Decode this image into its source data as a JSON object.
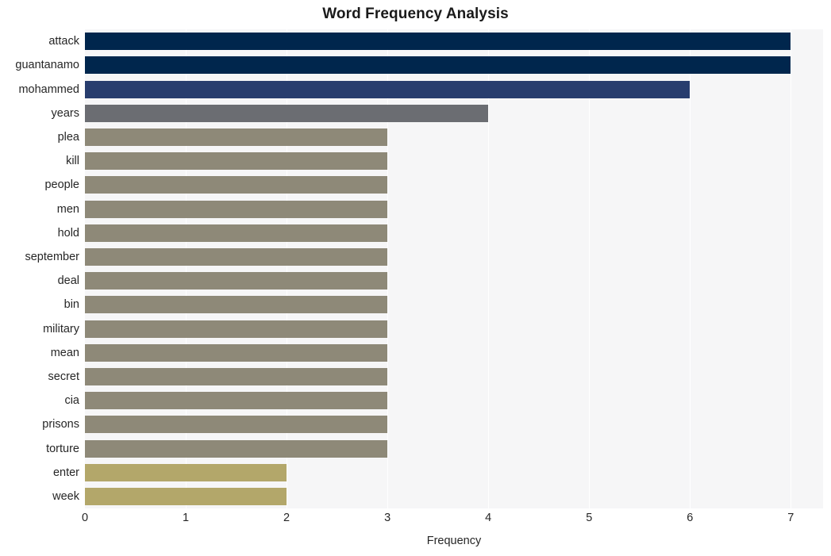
{
  "chart_data": {
    "type": "bar",
    "orientation": "horizontal",
    "title": "Word Frequency Analysis",
    "xlabel": "Frequency",
    "ylabel": "",
    "xlim": [
      0,
      7.32
    ],
    "xticks": [
      0,
      1,
      2,
      3,
      4,
      5,
      6,
      7
    ],
    "xtick_labels": [
      "0",
      "1",
      "2",
      "3",
      "4",
      "5",
      "6",
      "7"
    ],
    "grid": "vertical",
    "legend": "none",
    "categories": [
      "attack",
      "guantanamo",
      "mohammed",
      "years",
      "plea",
      "kill",
      "people",
      "men",
      "hold",
      "september",
      "deal",
      "bin",
      "military",
      "mean",
      "secret",
      "cia",
      "prisons",
      "torture",
      "enter",
      "week"
    ],
    "values": [
      7,
      7,
      6,
      4,
      3,
      3,
      3,
      3,
      3,
      3,
      3,
      3,
      3,
      3,
      3,
      3,
      3,
      3,
      2,
      2
    ],
    "bar_colors": [
      "#00264d",
      "#00264d",
      "#283d6e",
      "#6b6d72",
      "#8e8978",
      "#8e8978",
      "#8e8978",
      "#8e8978",
      "#8e8978",
      "#8e8978",
      "#8e8978",
      "#8e8978",
      "#8e8978",
      "#8e8978",
      "#8e8978",
      "#8e8978",
      "#8e8978",
      "#8e8978",
      "#b3a76a",
      "#b3a76a"
    ],
    "plot_background": "#f6f6f7",
    "figure_background": "#ffffff",
    "gridline_color": "#ffffff",
    "text_color": "#262626"
  }
}
